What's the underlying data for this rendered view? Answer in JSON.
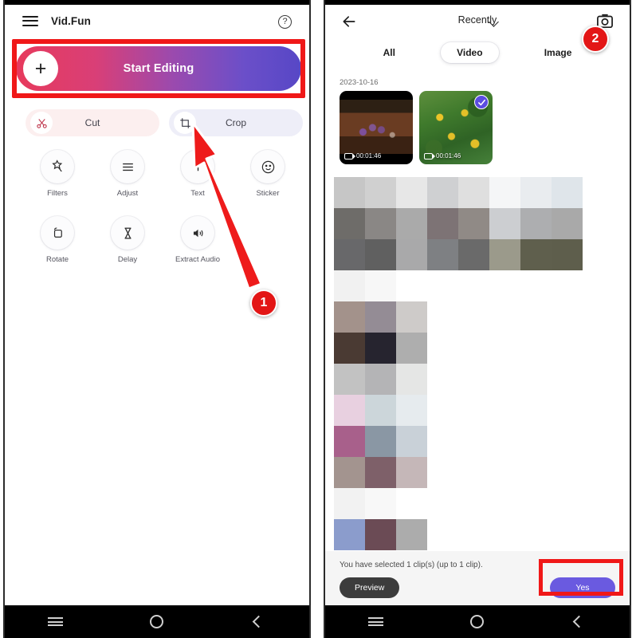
{
  "left_phone": {
    "header": {
      "menu_icon": "hamburger-menu-icon",
      "app_title": "Vid.Fun",
      "help_icon": "?"
    },
    "start_editing": {
      "label": "Start Editing",
      "plus_icon": "+",
      "gradient_from": "#e73a5c",
      "gradient_to": "#5747c6",
      "highlight_color": "#f01818"
    },
    "quick_actions": [
      {
        "label": "Cut",
        "icon": "scissors-icon",
        "bg": "#fcefef"
      },
      {
        "label": "Crop",
        "icon": "crop-icon",
        "bg": "#eeeef8"
      }
    ],
    "tools": [
      {
        "label": "Filters",
        "icon": "magic-wand-icon"
      },
      {
        "label": "Adjust",
        "icon": "sliders-icon"
      },
      {
        "label": "Text",
        "icon": "text-icon"
      },
      {
        "label": "Sticker",
        "icon": "smiley-icon"
      },
      {
        "label": "Rotate",
        "icon": "rotate-icon"
      },
      {
        "label": "Delay",
        "icon": "hourglass-icon"
      },
      {
        "label": "Extract Audio",
        "icon": "speaker-icon"
      }
    ],
    "step_badge": "1",
    "navbar": {
      "recents_icon": "recents-icon",
      "home_icon": "home-circle-icon",
      "back_icon": "back-chevron-icon"
    }
  },
  "right_phone": {
    "header": {
      "back_icon": "back-arrow-icon",
      "album_label": "Recently",
      "dropdown_icon": "chevron-down-icon",
      "camera_icon": "camera-icon"
    },
    "tabs": [
      {
        "label": "All",
        "active": false
      },
      {
        "label": "Video",
        "active": true
      },
      {
        "label": "Image",
        "active": false
      }
    ],
    "date_group": "2023-10-16",
    "clips": [
      {
        "duration": "00:01:46",
        "selected": false
      },
      {
        "duration": "00:01:46",
        "selected": true
      }
    ],
    "selection_accent": "#5b4ce0",
    "bottom": {
      "status": "You have selected 1 clip(s) (up to 1 clip).",
      "preview_label": "Preview",
      "confirm_label": "Yes",
      "confirm_color": "#6a5ae0",
      "highlight_color": "#f01818"
    },
    "step_badge": "2",
    "navbar": {
      "recents_icon": "recents-icon",
      "home_icon": "home-circle-icon",
      "back_icon": "back-chevron-icon"
    },
    "mosaic": {
      "cell_size": 39,
      "rows": [
        [
          "#c6c6c6",
          "#d0d0d0",
          "#e7e7e7",
          "#cfd0d2",
          "#dfdfdf",
          "#f5f6f7",
          "#e9ecef",
          "#dfe5ea"
        ],
        [
          "#6e6c69",
          "#8a8785",
          "#aaaaaa",
          "#7d7375",
          "#908a86",
          "#ccced1",
          "#adaeb0",
          "#a9a9a9"
        ],
        [
          "#68686a",
          "#606060",
          "#a9a9aa",
          "#7e8083",
          "#6a6a6a",
          "#9b9a8b",
          "#5f5f4d",
          "#5e5e4c"
        ],
        [
          "#f1f1f1",
          "#f7f7f7"
        ],
        [
          "#a3928b",
          "#948c95",
          "#cecbc9"
        ],
        [
          "#4a3a33",
          "#26242f",
          "#aeaeae"
        ],
        [
          "#c2c2c2",
          "#b4b4b6",
          "#e5e6e5"
        ],
        [
          "#e8d0e0",
          "#ccd6da",
          "#e6ebee"
        ],
        [
          "#a8608b",
          "#8a97a4",
          "#c9d1d8"
        ],
        [
          "#a3948f",
          "#7e6069",
          "#c5b7b8"
        ],
        [
          "#f2f2f2",
          "#f8f8f8"
        ],
        [
          "#8b9ccc",
          "#6b4b55",
          "#acacac"
        ]
      ]
    }
  }
}
